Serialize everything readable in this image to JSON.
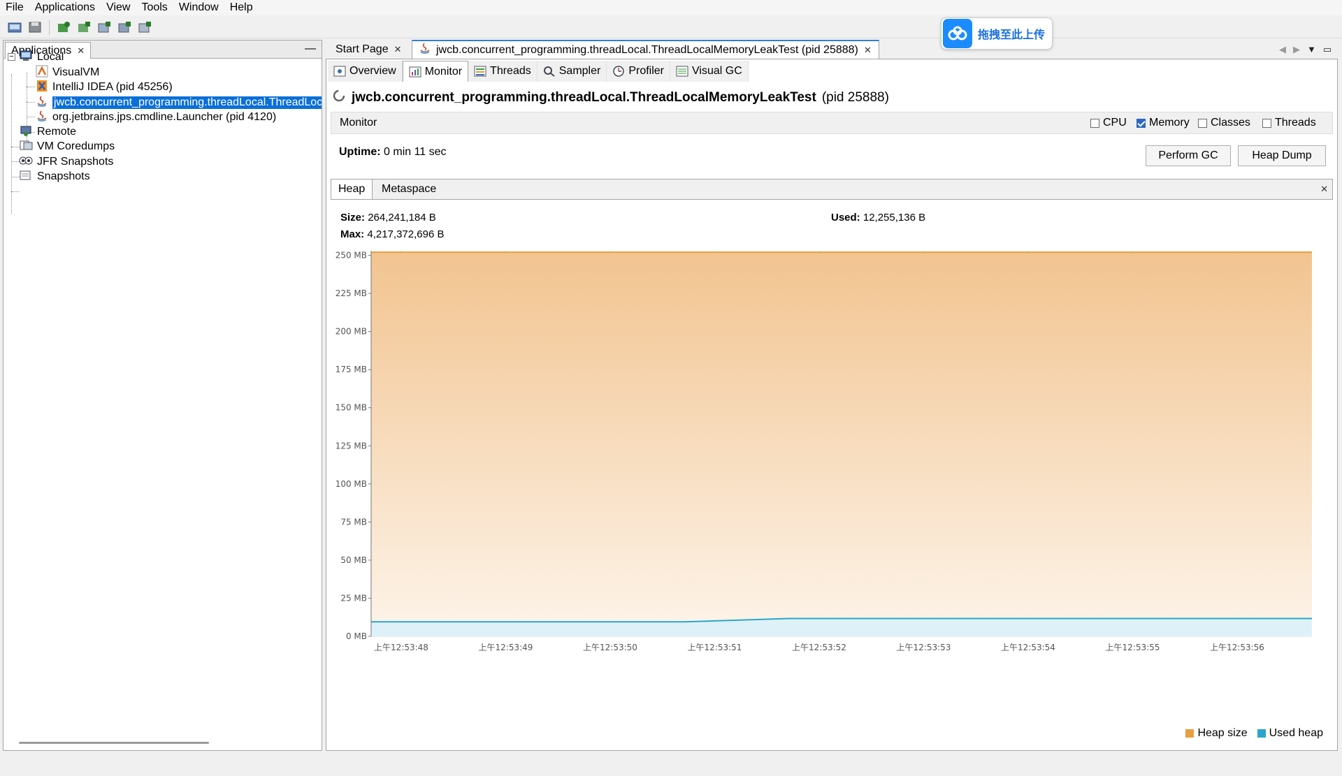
{
  "menu": [
    "File",
    "Applications",
    "View",
    "Tools",
    "Window",
    "Help"
  ],
  "left_panel": {
    "tab_label": "Applications",
    "tree": {
      "local": "Local",
      "visualvm": "VisualVM",
      "intellij": "IntelliJ IDEA (pid 45256)",
      "selected_app": "jwcb.concurrent_programming.threadLocal.ThreadLocalMemoryLeakTest",
      "launcher": "org.jetbrains.jps.cmdline.Launcher (pid 4120)",
      "remote": "Remote",
      "vm_coredumps": "VM Coredumps",
      "jfr_snapshots": "JFR Snapshots",
      "snapshots": "Snapshots"
    }
  },
  "editor_tabs": {
    "start_page": "Start Page",
    "active_tab": "jwcb.concurrent_programming.threadLocal.ThreadLocalMemoryLeakTest (pid 25888)"
  },
  "upload_widget": {
    "label": "拖拽至此上传"
  },
  "subtabs": [
    "Overview",
    "Monitor",
    "Threads",
    "Sampler",
    "Profiler",
    "Visual GC"
  ],
  "process": {
    "name": "jwcb.concurrent_programming.threadLocal.ThreadLocalMemoryLeakTest",
    "pid_text": "(pid 25888)"
  },
  "monitor": {
    "label": "Monitor",
    "checkboxes": [
      {
        "label": "CPU",
        "checked": false
      },
      {
        "label": "Memory",
        "checked": true
      },
      {
        "label": "Classes",
        "checked": false
      },
      {
        "label": "Threads",
        "checked": false
      }
    ],
    "uptime_label": "Uptime:",
    "uptime_value": "0 min 11 sec",
    "perform_gc": "Perform GC",
    "heap_dump": "Heap Dump"
  },
  "heap_tabs": [
    "Heap",
    "Metaspace"
  ],
  "stats": {
    "size_label": "Size:",
    "size_value": "264,241,184 B",
    "max_label": "Max:",
    "max_value": "4,217,372,696 B",
    "used_label": "Used:",
    "used_value": "12,255,136 B"
  },
  "colors": {
    "heap_size": "#e8a040",
    "used_heap": "#2aa6cc",
    "selection": "#0a6fd8"
  },
  "chart_data": {
    "type": "area",
    "yticks": [
      "0 MB",
      "25 MB",
      "50 MB",
      "75 MB",
      "100 MB",
      "125 MB",
      "150 MB",
      "175 MB",
      "200 MB",
      "225 MB",
      "250 MB"
    ],
    "ylim": [
      0,
      250
    ],
    "x": [
      "上午12:53:48",
      "上午12:53:49",
      "上午12:53:50",
      "上午12:53:51",
      "上午12:53:52",
      "上午12:53:53",
      "上午12:53:54",
      "上午12:53:55",
      "上午12:53:56"
    ],
    "series": [
      {
        "name": "Heap size",
        "values": [
          252,
          252,
          252,
          252,
          252,
          252,
          252,
          252,
          252,
          252
        ]
      },
      {
        "name": "Used heap",
        "values": [
          9.5,
          9.5,
          9.5,
          9.5,
          11.7,
          11.7,
          11.7,
          11.7,
          11.7,
          11.7
        ]
      }
    ],
    "legend": [
      "Heap size",
      "Used heap"
    ],
    "grid": true,
    "legend_position": "bottom-right"
  }
}
